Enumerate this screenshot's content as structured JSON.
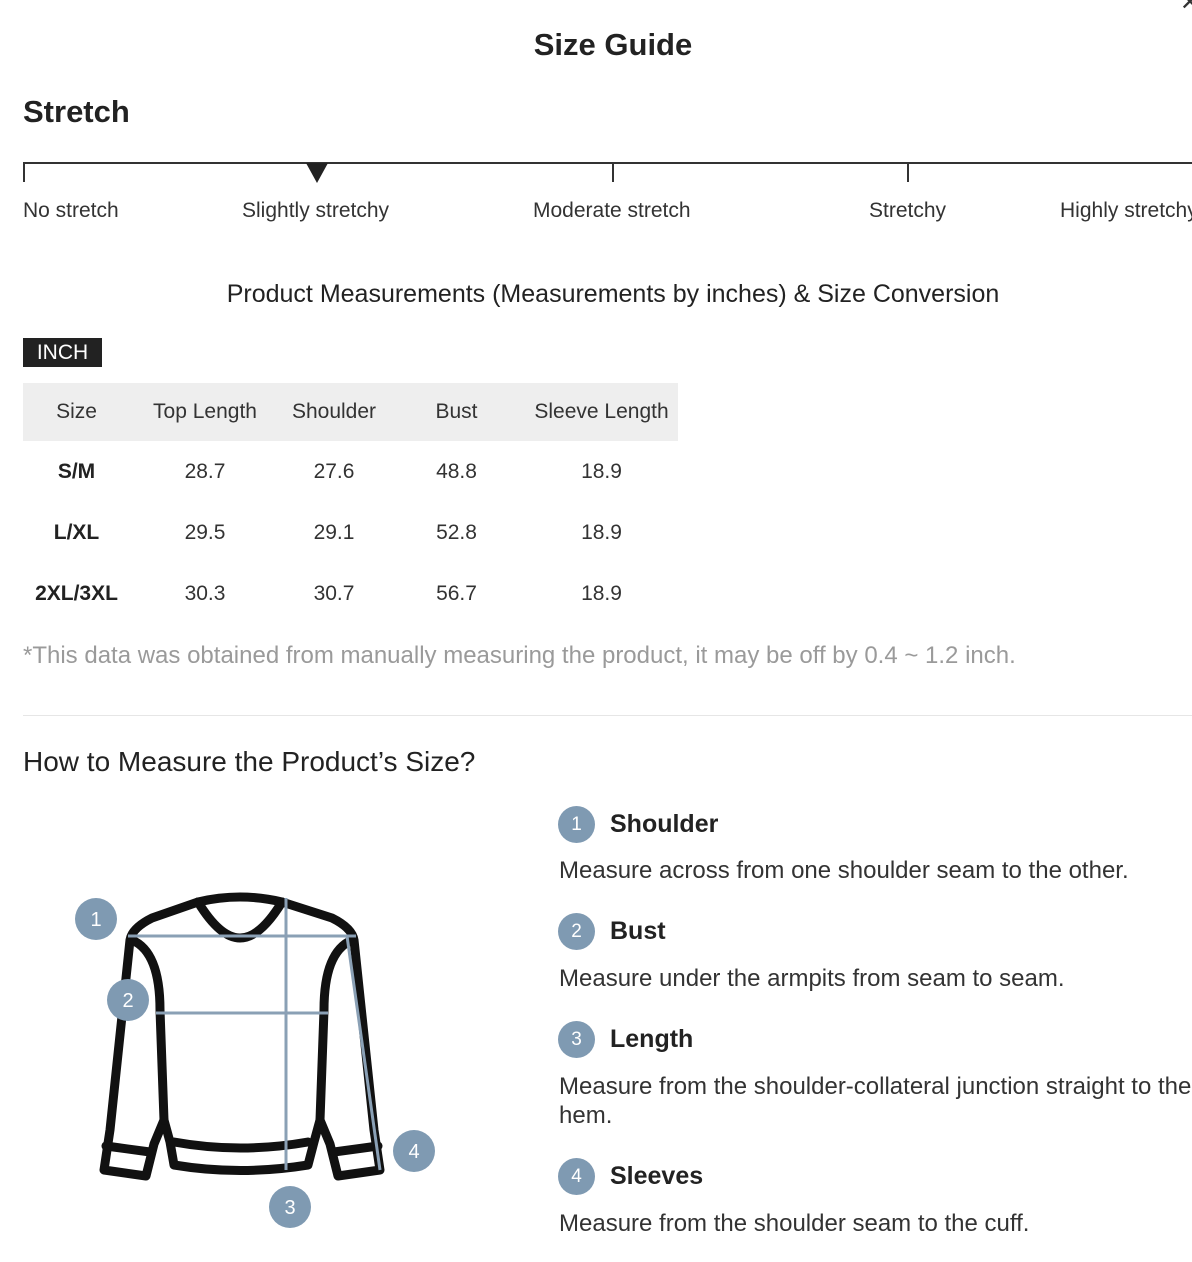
{
  "modal": {
    "title": "Size Guide",
    "close_icon": "close-icon"
  },
  "stretch": {
    "heading": "Stretch",
    "selected": "Slightly stretchy",
    "levels": [
      "No stretch",
      "Slightly stretchy",
      "Moderate stretch",
      "Stretchy",
      "Highly stretchy"
    ]
  },
  "measurements": {
    "heading": "Product Measurements (Measurements by inches) & Size Conversion",
    "unit": "INCH",
    "columns": [
      "Size",
      "Top Length",
      "Shoulder",
      "Bust",
      "Sleeve Length"
    ],
    "rows": [
      [
        "S/M",
        "28.7",
        "27.6",
        "48.8",
        "18.9"
      ],
      [
        "L/XL",
        "29.5",
        "29.1",
        "52.8",
        "18.9"
      ],
      [
        "2XL/3XL",
        "30.3",
        "30.7",
        "56.7",
        "18.9"
      ]
    ],
    "note": "*This data was obtained from manually measuring the product, it may be off by 0.4 ~ 1.2 inch."
  },
  "how_to_measure": {
    "heading": "How to Measure the Product’s Size?",
    "steps": [
      {
        "number": "1",
        "title": "Shoulder",
        "description": "Measure across from one shoulder seam to the other."
      },
      {
        "number": "2",
        "title": "Bust",
        "description": "Measure under the armpits from seam to seam."
      },
      {
        "number": "3",
        "title": "Length",
        "description": "Measure from the shoulder-collateral junction straight to the hem."
      },
      {
        "number": "4",
        "title": "Sleeves",
        "description": "Measure from the shoulder seam to the cuff."
      }
    ],
    "diagram_labels": [
      "1",
      "2",
      "3",
      "4"
    ],
    "accent_color": "#7f9ab2"
  }
}
